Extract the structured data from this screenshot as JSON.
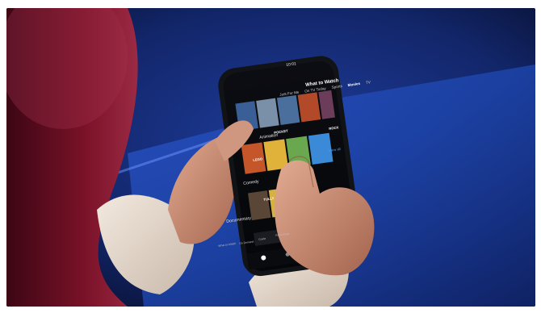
{
  "phone": {
    "status_time": "10:01",
    "app_title": "What to Watch",
    "tabs": [
      {
        "label": "Just For Me"
      },
      {
        "label": "On TV Today"
      },
      {
        "label": "Sports"
      },
      {
        "label": "Movies"
      },
      {
        "label": "TV"
      }
    ],
    "active_tab": "Movies",
    "rows": {
      "animation": "Animation",
      "comedy": "Comedy",
      "documentary": "Documentary",
      "view_all": "View all"
    },
    "posters": {
      "lego": "LEGO",
      "tully": "TULLY",
      "pocket": "POCKET",
      "rock": "ROCK"
    },
    "nav": [
      {
        "label": "What to Watch",
        "icon": "home-icon"
      },
      {
        "label": "On Demand",
        "icon": "play-icon"
      },
      {
        "label": "Guide",
        "icon": "grid-icon"
      },
      {
        "label": "Recordings",
        "icon": "record-icon"
      }
    ]
  },
  "colors": {
    "background_blue": "#1a3a8f",
    "sleeve_red": "#8a1530",
    "skin": "#c98d78",
    "sleeve_cream": "#e8ddd0",
    "phone_body": "#121316"
  }
}
